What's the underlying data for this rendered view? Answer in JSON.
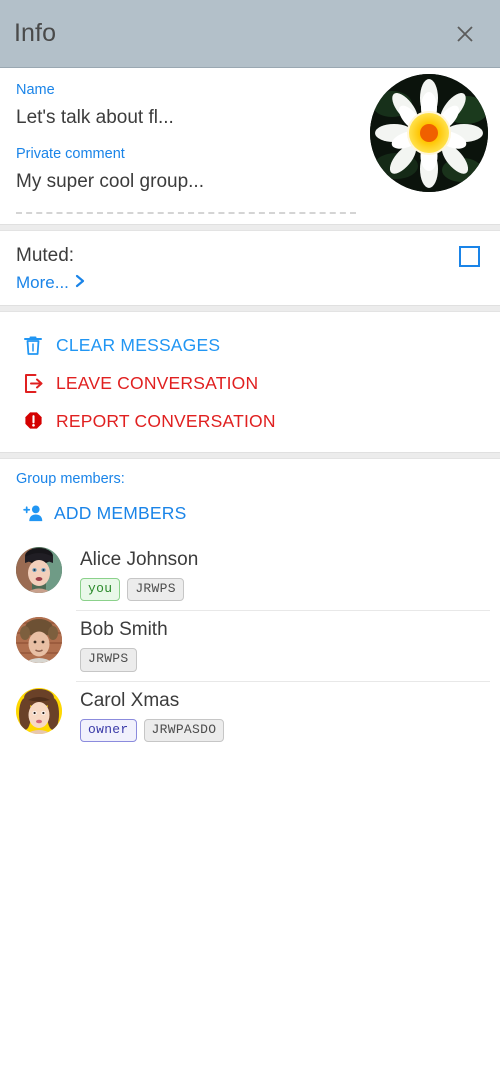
{
  "header": {
    "title": "Info",
    "close_icon": "close-icon"
  },
  "info": {
    "name_label": "Name",
    "name_value": "Let's talk about fl...",
    "comment_label": "Private comment",
    "comment_value": "My super cool group...",
    "avatar_icon": "group-avatar-lotus-image"
  },
  "muted": {
    "label": "Muted:",
    "checked": false,
    "more_label": "More...",
    "more_icon": "chevron-right-icon"
  },
  "actions": [
    {
      "label": "CLEAR MESSAGES",
      "icon": "trash-icon",
      "color": "#2196f3",
      "tone": "blue"
    },
    {
      "label": "LEAVE CONVERSATION",
      "icon": "exit-icon",
      "color": "#e02020",
      "tone": "red"
    },
    {
      "label": "REPORT CONVERSATION",
      "icon": "report-icon",
      "color": "#e02020",
      "tone": "red"
    }
  ],
  "members": {
    "title": "Group members:",
    "add_label": "ADD MEMBERS",
    "add_icon": "person-add-icon",
    "list": [
      {
        "name": "Alice Johnson",
        "avatar": "avatar-alice",
        "badges": [
          {
            "text": "you",
            "type": "you"
          },
          {
            "text": "JRWPS",
            "type": "perm"
          }
        ]
      },
      {
        "name": "Bob Smith",
        "avatar": "avatar-bob",
        "badges": [
          {
            "text": "JRWPS",
            "type": "perm"
          }
        ]
      },
      {
        "name": "Carol Xmas",
        "avatar": "avatar-carol",
        "badges": [
          {
            "text": "owner",
            "type": "owner"
          },
          {
            "text": "JRWPASDO",
            "type": "perm"
          }
        ]
      }
    ]
  },
  "colors": {
    "header_bg": "#b3c0c9",
    "accent_blue": "#1a84e8",
    "action_blue": "#2196f3",
    "danger_red": "#e02020",
    "section_gap": "#ececec"
  }
}
